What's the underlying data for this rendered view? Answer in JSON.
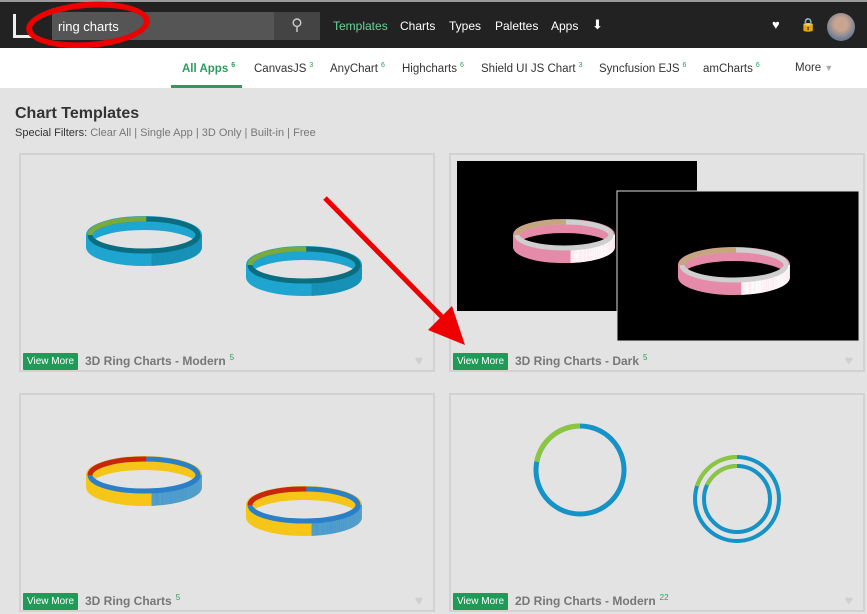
{
  "search": {
    "value": "ring charts"
  },
  "topnav": [
    {
      "label": "Templates",
      "active": true
    },
    {
      "label": "Charts"
    },
    {
      "label": "Types"
    },
    {
      "label": "Palettes"
    },
    {
      "label": "Apps"
    }
  ],
  "subnav": [
    {
      "label": "All Apps",
      "count": "6",
      "active": true
    },
    {
      "label": "CanvasJS",
      "count": "3"
    },
    {
      "label": "AnyChart",
      "count": "6"
    },
    {
      "label": "Highcharts",
      "count": "6"
    },
    {
      "label": "Shield UI JS Chart",
      "count": "3"
    },
    {
      "label": "Syncfusion EJS",
      "count": "6"
    },
    {
      "label": "amCharts",
      "count": "6"
    }
  ],
  "more_label": "More",
  "page_title": "Chart Templates",
  "filters": {
    "label": "Special Filters:",
    "items": [
      "Clear All",
      "Single App",
      "3D Only",
      "Built-in",
      "Free"
    ]
  },
  "view_more": "View More",
  "cards": [
    {
      "title": "3D Ring Charts - Modern",
      "count": "5",
      "style": "modern"
    },
    {
      "title": "3D Ring Charts - Dark",
      "count": "5",
      "style": "dark"
    },
    {
      "title": "3D Ring Charts",
      "count": "5",
      "style": "classic"
    },
    {
      "title": "2D Ring Charts - Modern",
      "count": "22",
      "style": "flat"
    }
  ],
  "colors": {
    "accent": "#219a57",
    "annotation": "#e00000",
    "topbar": "#222222"
  }
}
